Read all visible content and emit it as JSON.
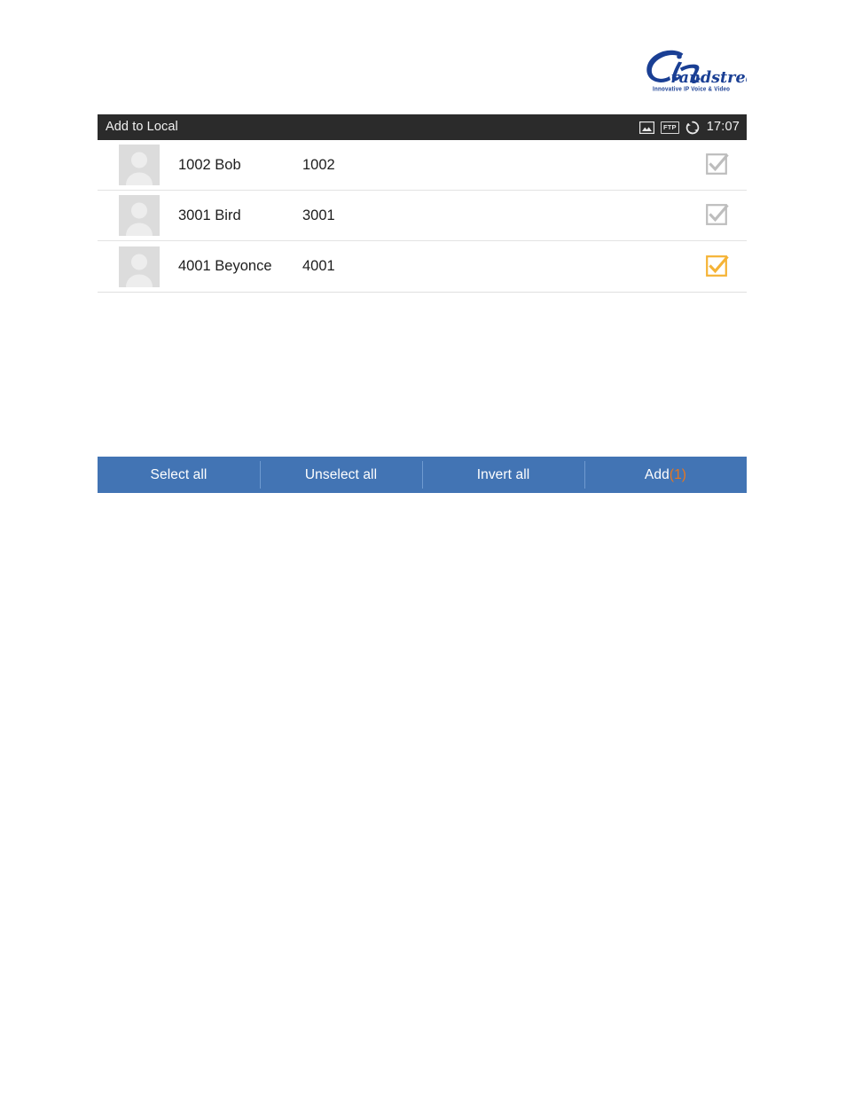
{
  "brand": {
    "name": "Grandstream",
    "tagline": "Innovative IP Voice & Video",
    "color": "#1a3f94"
  },
  "titlebar": {
    "title": "Add to Local",
    "background": "#2b2b2b",
    "text_color": "#f2f2f2"
  },
  "statusbar": {
    "icons": [
      {
        "name": "picture-icon",
        "label": ""
      },
      {
        "name": "ftp-icon",
        "label": "FTP"
      },
      {
        "name": "sync-icon",
        "label": ""
      }
    ],
    "ftp_label": "FTP",
    "clock": "17:07"
  },
  "contacts": {
    "rows": [
      {
        "name": "1002 Bob",
        "number": "1002",
        "checked": true,
        "check_state": "disabled",
        "check_color": "#bdbdbd"
      },
      {
        "name": "3001 Bird",
        "number": "3001",
        "checked": true,
        "check_state": "disabled",
        "check_color": "#bdbdbd"
      },
      {
        "name": "4001 Beyonce",
        "number": "4001",
        "checked": true,
        "check_state": "selected",
        "check_color": "#f5b335"
      }
    ]
  },
  "actionbar": {
    "background": "#4274b4",
    "buttons": [
      {
        "name": "select-all-button",
        "label": "Select all"
      },
      {
        "name": "unselect-all-button",
        "label": "Unselect all"
      },
      {
        "name": "invert-all-button",
        "label": "Invert all"
      },
      {
        "name": "add-button",
        "label": "Add",
        "count": "(1)",
        "count_color": "#e8761e"
      }
    ],
    "select_all_label": "Select all",
    "unselect_all_label": "Unselect all",
    "invert_all_label": "Invert all",
    "add_label": "Add",
    "add_count": "(1)"
  }
}
